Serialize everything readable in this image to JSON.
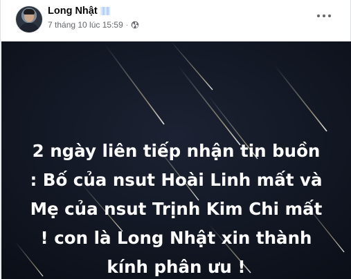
{
  "post": {
    "author_name": "Long Nhật",
    "timestamp": "7 tháng 10 lúc 15:59",
    "separator": "·",
    "privacy_icon": "globe-icon",
    "more_icon": "more-dots-icon"
  },
  "image": {
    "text_lines": [
      "2 ngày liên tiếp nhận tin buồn",
      ": Bố của nsut Hoài Linh mất và",
      "Mẹ của nsut Trịnh Kim Chi mất",
      "! con là Long Nhật xin thành",
      "kính phân ưu !"
    ],
    "background_color": "#101522",
    "text_color": "#ffffff"
  }
}
